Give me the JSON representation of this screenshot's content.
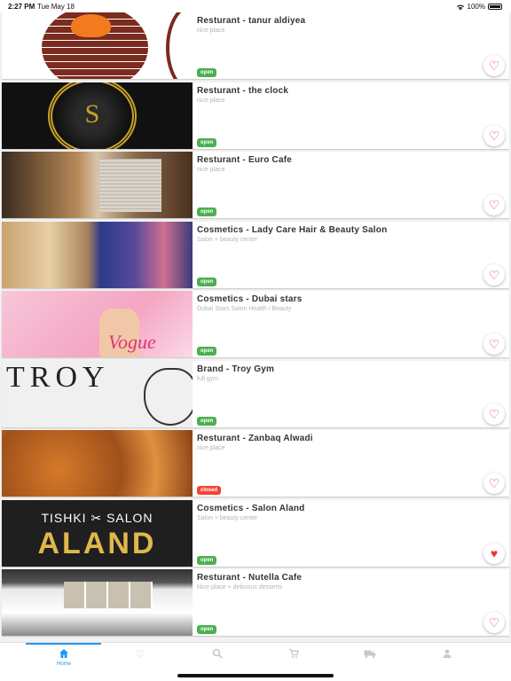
{
  "status_bar": {
    "time": "2:27 PM",
    "date": "Tue May 18",
    "wifi_icon": "wifi-icon",
    "battery": "100%"
  },
  "places": [
    {
      "title": "Resturant - tanur aldiyea",
      "subtitle": "nice place",
      "status": "open",
      "favorite": false
    },
    {
      "title": "Resturant - the clock",
      "subtitle": "nice place",
      "status": "open",
      "favorite": false
    },
    {
      "title": "Resturant - Euro Cafe",
      "subtitle": "nice place",
      "status": "open",
      "favorite": false
    },
    {
      "title": "Cosmetics - Lady Care Hair & Beauty Salon",
      "subtitle": "Salon + beauty center",
      "status": "open",
      "favorite": false
    },
    {
      "title": "Cosmetics -  Dubai stars",
      "subtitle": "Dubai Stars Salon Health / Beauty",
      "status": "open",
      "favorite": false
    },
    {
      "title": "Brand - Troy Gym",
      "subtitle": "full gym",
      "status": "open",
      "favorite": false
    },
    {
      "title": "Resturant - Zanbaq Alwadi",
      "subtitle": "nice place",
      "status": "closed",
      "favorite": false
    },
    {
      "title": "Cosmetics -  Salon Aland",
      "subtitle": "Salon + beauty center",
      "status": "open",
      "favorite": true
    },
    {
      "title": "Resturant  - Nutella Cafe",
      "subtitle": "Nice place + delicious desserts",
      "status": "open",
      "favorite": false
    }
  ],
  "thumb_text": {
    "clock_letter": "S",
    "aland_top": "TISHKI ✂ SALON",
    "aland_big": "ALAND",
    "troy": "TROY",
    "vogue": "Vogue"
  },
  "tabs": [
    {
      "label": "Home",
      "icon": "home-icon",
      "active": true
    },
    {
      "label": "",
      "icon": "heart-icon",
      "active": false
    },
    {
      "label": "",
      "icon": "search-icon",
      "active": false
    },
    {
      "label": "",
      "icon": "cart-icon",
      "active": false
    },
    {
      "label": "",
      "icon": "truck-icon",
      "active": false
    },
    {
      "label": "",
      "icon": "person-icon",
      "active": false
    }
  ],
  "colors": {
    "accent": "#2196f3",
    "open": "#4caf50",
    "closed": "#f44336",
    "heart": "#e53935"
  }
}
